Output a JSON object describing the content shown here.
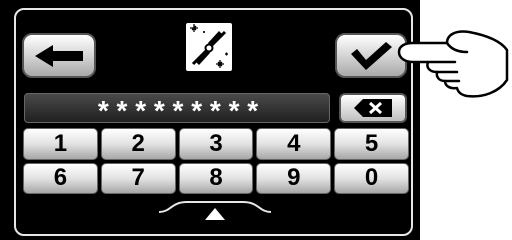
{
  "header": {
    "back_icon": "left-arrow-icon",
    "mode_icon": "fan-blade-sparkle-icon",
    "confirm_icon": "check-icon"
  },
  "password": {
    "value": "* * * * * * * * *",
    "backspace_icon": "backspace-x-icon"
  },
  "keypad": {
    "keys": [
      "1",
      "2",
      "3",
      "4",
      "5",
      "6",
      "7",
      "8",
      "9",
      "0"
    ]
  },
  "footer": {
    "toggle_icon": "up-triangle-icon"
  },
  "overlay": {
    "pointer_icon": "pointing-hand-icon"
  },
  "colors": {
    "screen": "#000000",
    "key_light": "#ffffff",
    "key_dark": "#a7a7a7"
  }
}
